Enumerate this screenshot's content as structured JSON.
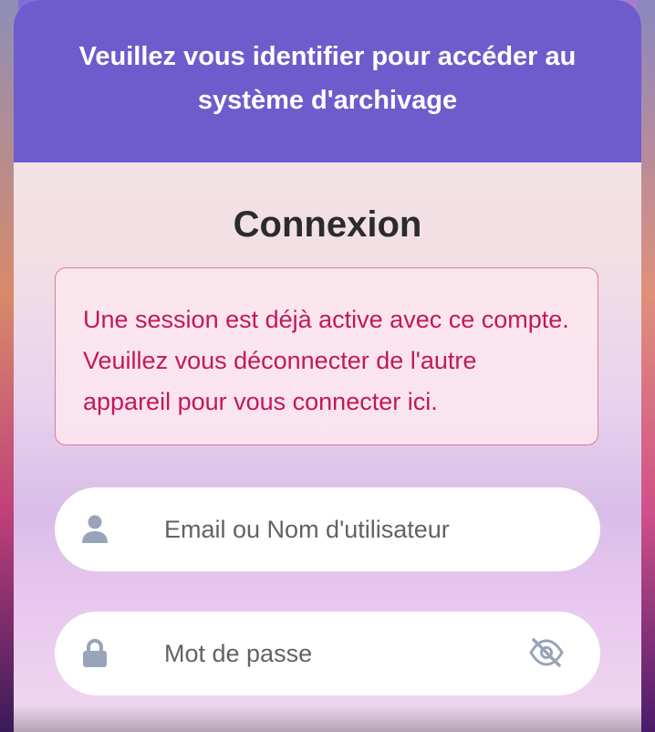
{
  "header": {
    "text": "Veuillez vous identifier pour accéder au système d'archivage"
  },
  "login": {
    "title": "Connexion",
    "alert": "Une session est déjà active avec ce compte. Veuillez vous déconnecter de l'autre appareil pour vous connecter ici.",
    "username_placeholder": "Email ou Nom d'utilisateur",
    "password_placeholder": "Mot de passe"
  },
  "icons": {
    "username": "user-icon",
    "password": "lock-icon",
    "toggle_visibility": "eye-off-icon"
  },
  "colors": {
    "header_bg": "#6e5ccd",
    "alert_text": "#c2185b",
    "alert_border": "#e07a9a",
    "icon_gray": "#9aa4b8"
  }
}
